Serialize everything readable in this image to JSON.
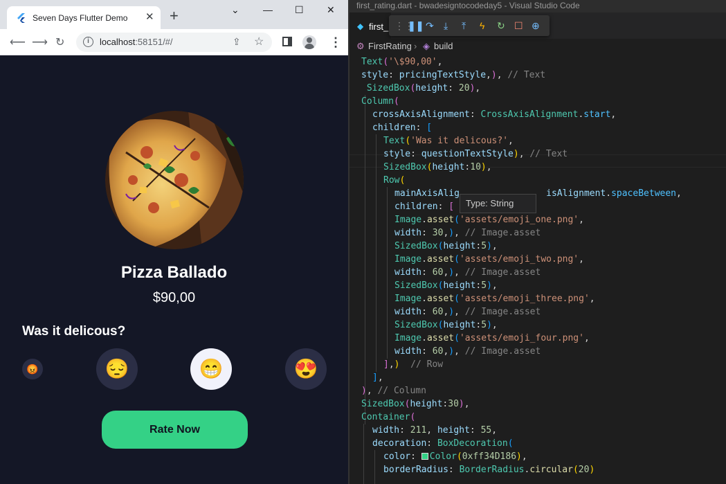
{
  "browser": {
    "tab_title": "Seven Days Flutter Demo",
    "tab_close": "✕",
    "new_tab": "+",
    "window_controls": {
      "minimize": "—",
      "maximize": "☐",
      "close": "✕",
      "dropdown": "⌄"
    },
    "url_host": "localhost",
    "url_rest": ":58151/#/",
    "icons": [
      "back-arrow-icon",
      "forward-arrow-icon",
      "reload-icon",
      "info-icon",
      "share-icon",
      "star-icon",
      "side-panel-icon",
      "avatar-icon",
      "menu-icon"
    ]
  },
  "app": {
    "dish_name": "Pizza Ballado",
    "price": "$90,00",
    "question": "Was it delicous?",
    "emojis": [
      {
        "glyph": "😡",
        "name": "angry"
      },
      {
        "glyph": "😔",
        "name": "sad"
      },
      {
        "glyph": "😁",
        "name": "happy",
        "selected": true
      },
      {
        "glyph": "😍",
        "name": "love"
      }
    ],
    "rate_button": "Rate Now",
    "button_color": "#34d186"
  },
  "vscode": {
    "window_title": "first_rating.dart - bwadesigntocodeday5 - Visual Studio Code",
    "file_tab": "first_",
    "breadcrumb": [
      "FirstRating",
      "build"
    ],
    "tooltip_label": "Type:",
    "tooltip_value": "String"
  }
}
